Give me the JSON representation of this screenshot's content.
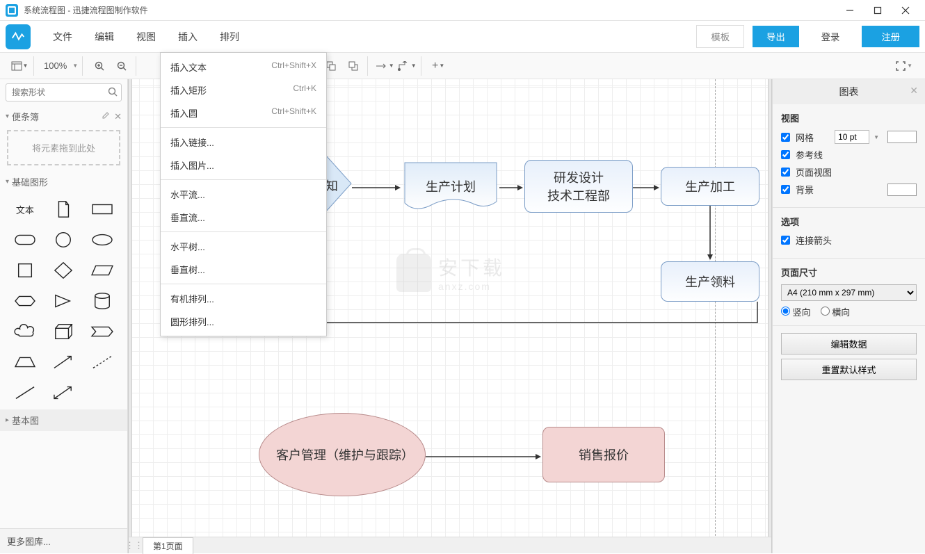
{
  "window_title": "系统流程图 - 迅捷流程图制作软件",
  "menubar": {
    "items": [
      "文件",
      "编辑",
      "视图",
      "插入",
      "排列"
    ],
    "template": "模板",
    "export": "导出",
    "login": "登录",
    "register": "注册"
  },
  "toolbar": {
    "zoom": "100%"
  },
  "search": {
    "placeholder": "搜索形状"
  },
  "left": {
    "scratch_title": "便条簿",
    "drop_hint": "将元素拖到此处",
    "basic_shapes": "基础图形",
    "basic_diagram": "基本图",
    "text_label": "文本",
    "more_shapes": "更多图库..."
  },
  "insert_menu": [
    {
      "label": "插入文本",
      "shortcut": "Ctrl+Shift+X"
    },
    {
      "label": "插入矩形",
      "shortcut": "Ctrl+K"
    },
    {
      "label": "插入圆",
      "shortcut": "Ctrl+Shift+K"
    },
    {
      "sep": true
    },
    {
      "label": "插入链接..."
    },
    {
      "label": "插入图片..."
    },
    {
      "sep": true
    },
    {
      "label": "水平流..."
    },
    {
      "label": "垂直流..."
    },
    {
      "sep": true
    },
    {
      "label": "水平树..."
    },
    {
      "label": "垂直树..."
    },
    {
      "sep": true
    },
    {
      "label": "有机排列..."
    },
    {
      "label": "圆形排列..."
    }
  ],
  "canvas": {
    "diamond_label": "知",
    "plan": "生产计划",
    "rd": "研发设计\n技术工程部",
    "process": "生产加工",
    "material": "生产领料",
    "customer": "客户管理（维护与跟踪）",
    "quote": "销售报价",
    "watermark_zh": "安下载",
    "watermark_url": "anxz.com"
  },
  "right": {
    "header": "图表",
    "view": "视图",
    "grid": "网格",
    "grid_pt": "10 pt",
    "guides": "参考线",
    "page_view": "页面视图",
    "background": "背景",
    "options": "选项",
    "conn_arrow": "连接箭头",
    "page_size": "页面尺寸",
    "a4": "A4 (210 mm x 297 mm)",
    "portrait": "竖向",
    "landscape": "横向",
    "edit_data": "编辑数据",
    "reset_style": "重置默认样式"
  },
  "status": {
    "page_tab": "第1页面"
  }
}
